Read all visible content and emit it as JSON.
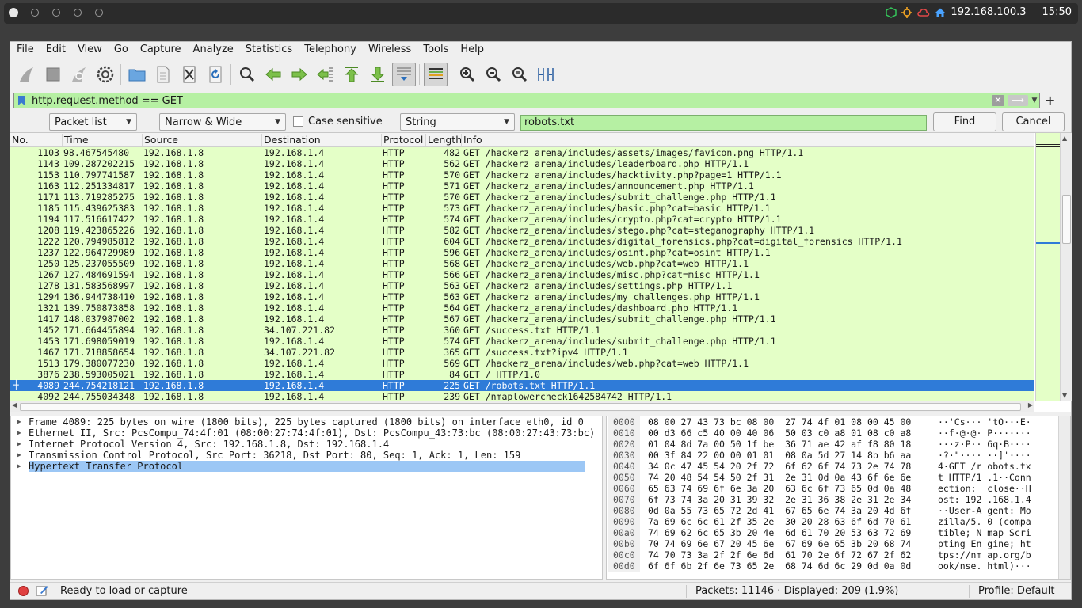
{
  "topbar": {
    "ip": "192.168.100.3",
    "time": "15:50"
  },
  "menu": [
    "File",
    "Edit",
    "View",
    "Go",
    "Capture",
    "Analyze",
    "Statistics",
    "Telephony",
    "Wireless",
    "Tools",
    "Help"
  ],
  "display_filter": {
    "value": "http.request.method == GET"
  },
  "find": {
    "search_in": "Packet list",
    "char_width": "Narrow & Wide",
    "case_sensitive_label": "Case sensitive",
    "search_type": "String",
    "query": "robots.txt",
    "find_label": "Find",
    "cancel_label": "Cancel"
  },
  "columns": [
    "No.",
    "Time",
    "Source",
    "Destination",
    "Protocol",
    "Length",
    "Info"
  ],
  "packets": [
    {
      "no": "1103",
      "time": "98.467545480",
      "src": "192.168.1.8",
      "dst": "192.168.1.4",
      "proto": "HTTP",
      "len": "482",
      "info": "GET /hackerz_arena/includes/assets/images/favicon.png HTTP/1.1"
    },
    {
      "no": "1143",
      "time": "109.287202215",
      "src": "192.168.1.8",
      "dst": "192.168.1.4",
      "proto": "HTTP",
      "len": "562",
      "info": "GET /hackerz_arena/includes/leaderboard.php HTTP/1.1"
    },
    {
      "no": "1153",
      "time": "110.797741587",
      "src": "192.168.1.8",
      "dst": "192.168.1.4",
      "proto": "HTTP",
      "len": "570",
      "info": "GET /hackerz_arena/includes/hacktivity.php?page=1 HTTP/1.1"
    },
    {
      "no": "1163",
      "time": "112.251334817",
      "src": "192.168.1.8",
      "dst": "192.168.1.4",
      "proto": "HTTP",
      "len": "571",
      "info": "GET /hackerz_arena/includes/announcement.php HTTP/1.1"
    },
    {
      "no": "1171",
      "time": "113.719285275",
      "src": "192.168.1.8",
      "dst": "192.168.1.4",
      "proto": "HTTP",
      "len": "570",
      "info": "GET /hackerz_arena/includes/submit_challenge.php HTTP/1.1"
    },
    {
      "no": "1185",
      "time": "115.439625383",
      "src": "192.168.1.8",
      "dst": "192.168.1.4",
      "proto": "HTTP",
      "len": "573",
      "info": "GET /hackerz_arena/includes/basic.php?cat=basic HTTP/1.1"
    },
    {
      "no": "1194",
      "time": "117.516617422",
      "src": "192.168.1.8",
      "dst": "192.168.1.4",
      "proto": "HTTP",
      "len": "574",
      "info": "GET /hackerz_arena/includes/crypto.php?cat=crypto HTTP/1.1"
    },
    {
      "no": "1208",
      "time": "119.423865226",
      "src": "192.168.1.8",
      "dst": "192.168.1.4",
      "proto": "HTTP",
      "len": "582",
      "info": "GET /hackerz_arena/includes/stego.php?cat=steganography HTTP/1.1"
    },
    {
      "no": "1222",
      "time": "120.794985812",
      "src": "192.168.1.8",
      "dst": "192.168.1.4",
      "proto": "HTTP",
      "len": "604",
      "info": "GET /hackerz_arena/includes/digital_forensics.php?cat=digital_forensics HTTP/1.1"
    },
    {
      "no": "1237",
      "time": "122.964729989",
      "src": "192.168.1.8",
      "dst": "192.168.1.4",
      "proto": "HTTP",
      "len": "596",
      "info": "GET /hackerz_arena/includes/osint.php?cat=osint HTTP/1.1"
    },
    {
      "no": "1250",
      "time": "125.237055509",
      "src": "192.168.1.8",
      "dst": "192.168.1.4",
      "proto": "HTTP",
      "len": "568",
      "info": "GET /hackerz_arena/includes/web.php?cat=web HTTP/1.1"
    },
    {
      "no": "1267",
      "time": "127.484691594",
      "src": "192.168.1.8",
      "dst": "192.168.1.4",
      "proto": "HTTP",
      "len": "566",
      "info": "GET /hackerz_arena/includes/misc.php?cat=misc HTTP/1.1"
    },
    {
      "no": "1278",
      "time": "131.583568997",
      "src": "192.168.1.8",
      "dst": "192.168.1.4",
      "proto": "HTTP",
      "len": "563",
      "info": "GET /hackerz_arena/includes/settings.php HTTP/1.1"
    },
    {
      "no": "1294",
      "time": "136.944738410",
      "src": "192.168.1.8",
      "dst": "192.168.1.4",
      "proto": "HTTP",
      "len": "563",
      "info": "GET /hackerz_arena/includes/my_challenges.php HTTP/1.1"
    },
    {
      "no": "1321",
      "time": "139.750873858",
      "src": "192.168.1.8",
      "dst": "192.168.1.4",
      "proto": "HTTP",
      "len": "564",
      "info": "GET /hackerz_arena/includes/dashboard.php HTTP/1.1"
    },
    {
      "no": "1417",
      "time": "148.037987002",
      "src": "192.168.1.8",
      "dst": "192.168.1.4",
      "proto": "HTTP",
      "len": "567",
      "info": "GET /hackerz_arena/includes/submit_challenge.php HTTP/1.1"
    },
    {
      "no": "1452",
      "time": "171.664455894",
      "src": "192.168.1.8",
      "dst": "34.107.221.82",
      "proto": "HTTP",
      "len": "360",
      "info": "GET /success.txt HTTP/1.1"
    },
    {
      "no": "1453",
      "time": "171.698059019",
      "src": "192.168.1.8",
      "dst": "192.168.1.4",
      "proto": "HTTP",
      "len": "574",
      "info": "GET /hackerz_arena/includes/submit_challenge.php HTTP/1.1"
    },
    {
      "no": "1467",
      "time": "171.718858654",
      "src": "192.168.1.8",
      "dst": "34.107.221.82",
      "proto": "HTTP",
      "len": "365",
      "info": "GET /success.txt?ipv4 HTTP/1.1"
    },
    {
      "no": "1513",
      "time": "179.380077230",
      "src": "192.168.1.8",
      "dst": "192.168.1.4",
      "proto": "HTTP",
      "len": "569",
      "info": "GET /hackerz_arena/includes/web.php?cat=web HTTP/1.1"
    },
    {
      "no": "3876",
      "time": "238.593005021",
      "src": "192.168.1.8",
      "dst": "192.168.1.4",
      "proto": "HTTP",
      "len": "84",
      "info": "GET / HTTP/1.0"
    },
    {
      "no": "4089",
      "time": "244.754218121",
      "src": "192.168.1.8",
      "dst": "192.168.1.4",
      "proto": "HTTP",
      "len": "225",
      "info": "GET /robots.txt HTTP/1.1",
      "selected": true
    },
    {
      "no": "4092",
      "time": "244.755034348",
      "src": "192.168.1.8",
      "dst": "192.168.1.4",
      "proto": "HTTP",
      "len": "239",
      "info": "GET /nmaplowercheck1642584742 HTTP/1.1"
    }
  ],
  "details": [
    "Frame 4089: 225 bytes on wire (1800 bits), 225 bytes captured (1800 bits) on interface eth0, id 0",
    "Ethernet II, Src: PcsCompu_74:4f:01 (08:00:27:74:4f:01), Dst: PcsCompu_43:73:bc (08:00:27:43:73:bc)",
    "Internet Protocol Version 4, Src: 192.168.1.8, Dst: 192.168.1.4",
    "Transmission Control Protocol, Src Port: 36218, Dst Port: 80, Seq: 1, Ack: 1, Len: 159",
    "Hypertext Transfer Protocol"
  ],
  "bytes": [
    {
      "off": "0000",
      "hex": "08 00 27 43 73 bc 08 00  27 74 4f 01 08 00 45 00",
      "asc": "··'Cs··· 'tO···E·"
    },
    {
      "off": "0010",
      "hex": "00 d3 66 c5 40 00 40 06  50 03 c0 a8 01 08 c0 a8",
      "asc": "··f·@·@· P·······"
    },
    {
      "off": "0020",
      "hex": "01 04 8d 7a 00 50 1f be  36 71 ae 42 af f8 80 18",
      "asc": "···z·P·· 6q·B····"
    },
    {
      "off": "0030",
      "hex": "00 3f 84 22 00 00 01 01  08 0a 5d 27 14 8b b6 aa",
      "asc": "·?·\"···· ··]'····"
    },
    {
      "off": "0040",
      "hex": "34 0c 47 45 54 20 2f 72  6f 62 6f 74 73 2e 74 78",
      "asc": "4·GET /r obots.tx"
    },
    {
      "off": "0050",
      "hex": "74 20 48 54 54 50 2f 31  2e 31 0d 0a 43 6f 6e 6e",
      "asc": "t HTTP/1 .1··Conn"
    },
    {
      "off": "0060",
      "hex": "65 63 74 69 6f 6e 3a 20  63 6c 6f 73 65 0d 0a 48",
      "asc": "ection:  close··H"
    },
    {
      "off": "0070",
      "hex": "6f 73 74 3a 20 31 39 32  2e 31 36 38 2e 31 2e 34",
      "asc": "ost: 192 .168.1.4"
    },
    {
      "off": "0080",
      "hex": "0d 0a 55 73 65 72 2d 41  67 65 6e 74 3a 20 4d 6f",
      "asc": "··User-A gent: Mo"
    },
    {
      "off": "0090",
      "hex": "7a 69 6c 6c 61 2f 35 2e  30 20 28 63 6f 6d 70 61",
      "asc": "zilla/5. 0 (compa"
    },
    {
      "off": "00a0",
      "hex": "74 69 62 6c 65 3b 20 4e  6d 61 70 20 53 63 72 69",
      "asc": "tible; N map Scri"
    },
    {
      "off": "00b0",
      "hex": "70 74 69 6e 67 20 45 6e  67 69 6e 65 3b 20 68 74",
      "asc": "pting En gine; ht"
    },
    {
      "off": "00c0",
      "hex": "74 70 73 3a 2f 2f 6e 6d  61 70 2e 6f 72 67 2f 62",
      "asc": "tps://nm ap.org/b"
    },
    {
      "off": "00d0",
      "hex": "6f 6f 6b 2f 6e 73 65 2e  68 74 6d 6c 29 0d 0a 0d",
      "asc": "ook/nse. html)···"
    }
  ],
  "status": {
    "message": "Ready to load or capture",
    "packets": "Packets: 11146 · Displayed: 209 (1.9%)",
    "profile": "Profile: Default"
  },
  "colors": {
    "row_bg": "#e4ffc7",
    "selected_row": "#2f7bd8",
    "filter_bg": "#b6f0a3"
  }
}
